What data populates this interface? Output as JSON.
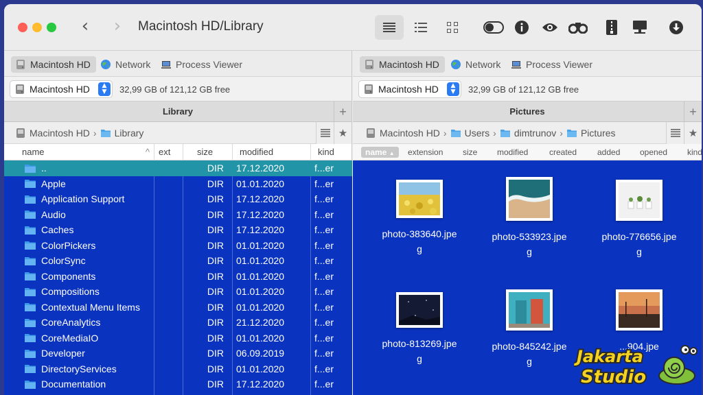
{
  "window": {
    "title": "Macintosh HD/Library"
  },
  "tabs": [
    {
      "label": "Macintosh HD",
      "icon": "disk-icon"
    },
    {
      "label": "Network",
      "icon": "globe-icon"
    },
    {
      "label": "Process Viewer",
      "icon": "monitor-icon"
    }
  ],
  "left": {
    "volume": "Macintosh HD",
    "free_space": "32,99 GB of 121,12 GB free",
    "pane_title": "Library",
    "path": [
      "Macintosh HD",
      "Library"
    ],
    "columns": [
      "name",
      "ext",
      "size",
      "modified",
      "kind"
    ],
    "rows": [
      {
        "name": "..",
        "size": "DIR",
        "modified": "17.12.2020",
        "kind": "f...er"
      },
      {
        "name": "Apple",
        "size": "DIR",
        "modified": "01.01.2020",
        "kind": "f...er"
      },
      {
        "name": "Application Support",
        "size": "DIR",
        "modified": "17.12.2020",
        "kind": "f...er"
      },
      {
        "name": "Audio",
        "size": "DIR",
        "modified": "17.12.2020",
        "kind": "f...er"
      },
      {
        "name": "Caches",
        "size": "DIR",
        "modified": "17.12.2020",
        "kind": "f...er"
      },
      {
        "name": "ColorPickers",
        "size": "DIR",
        "modified": "01.01.2020",
        "kind": "f...er"
      },
      {
        "name": "ColorSync",
        "size": "DIR",
        "modified": "01.01.2020",
        "kind": "f...er"
      },
      {
        "name": "Components",
        "size": "DIR",
        "modified": "01.01.2020",
        "kind": "f...er"
      },
      {
        "name": "Compositions",
        "size": "DIR",
        "modified": "01.01.2020",
        "kind": "f...er"
      },
      {
        "name": "Contextual Menu Items",
        "size": "DIR",
        "modified": "01.01.2020",
        "kind": "f...er"
      },
      {
        "name": "CoreAnalytics",
        "size": "DIR",
        "modified": "21.12.2020",
        "kind": "f...er"
      },
      {
        "name": "CoreMediaIO",
        "size": "DIR",
        "modified": "01.01.2020",
        "kind": "f...er"
      },
      {
        "name": "Developer",
        "size": "DIR",
        "modified": "06.09.2019",
        "kind": "f...er"
      },
      {
        "name": "DirectoryServices",
        "size": "DIR",
        "modified": "01.01.2020",
        "kind": "f...er"
      },
      {
        "name": "Documentation",
        "size": "DIR",
        "modified": "17.12.2020",
        "kind": "f...er"
      }
    ]
  },
  "right": {
    "volume": "Macintosh HD",
    "free_space": "32,99 GB of 121,12 GB free",
    "pane_title": "Pictures",
    "path": [
      "Macintosh HD",
      "Users",
      "dimtrunov",
      "Pictures"
    ],
    "columns": [
      "name",
      "extension",
      "size",
      "modified",
      "created",
      "added",
      "opened",
      "kind"
    ],
    "files": [
      {
        "line1": "photo-383640.jpe",
        "line2": "g"
      },
      {
        "line1": "photo-533923.jpe",
        "line2": "g"
      },
      {
        "line1": "photo-776656.jpe",
        "line2": "g"
      },
      {
        "line1": "photo-813269.jpe",
        "line2": "g"
      },
      {
        "line1": "photo-845242.jpe",
        "line2": "g"
      },
      {
        "line1": "...904.jpe",
        "line2": ""
      }
    ]
  },
  "watermark": {
    "line1": "Jakarta",
    "line2": "Studio"
  },
  "colors": {
    "list_bg": "#0a33bf",
    "cursor_row": "#2294a8",
    "accent": "#2a7af3"
  }
}
